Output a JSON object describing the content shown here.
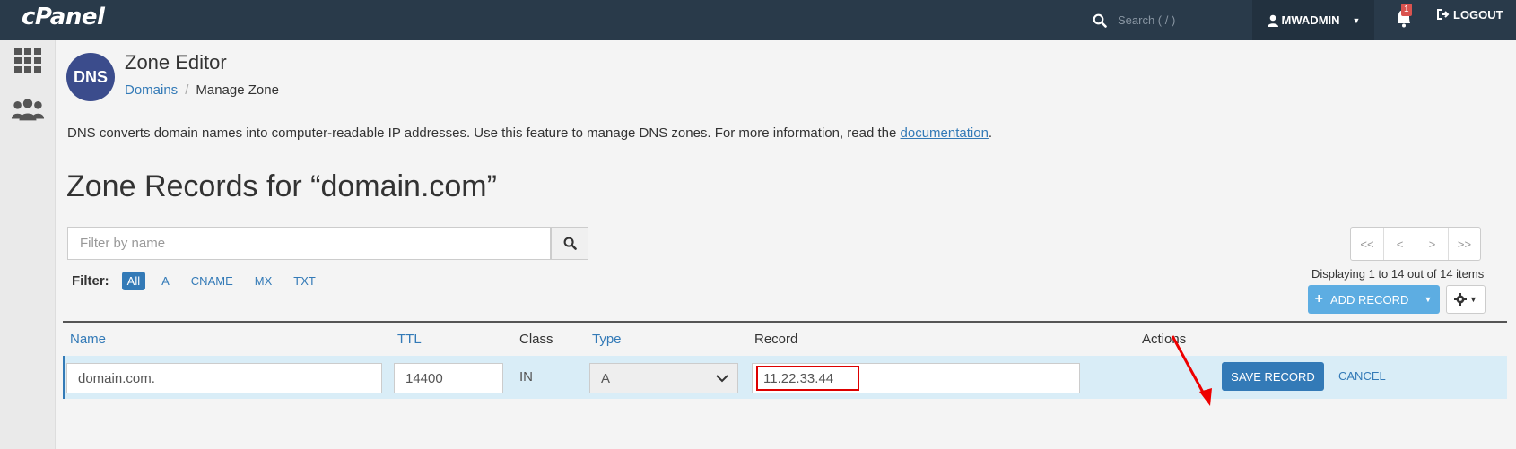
{
  "header": {
    "logo": "cPanel",
    "search_placeholder": "Search ( / )",
    "user": "MWADMIN",
    "notifications_count": "1",
    "logout_label": "LOGOUT"
  },
  "sidebar": {
    "items": [
      {
        "icon": "grid-icon"
      },
      {
        "icon": "users-icon"
      }
    ]
  },
  "page": {
    "logo_text": "DNS",
    "title": "Zone Editor",
    "breadcrumb": [
      "Domains",
      "Manage Zone"
    ],
    "description_prefix": "DNS converts domain names into computer-readable IP addresses. Use this feature to manage DNS zones. For more information, read the ",
    "description_link": "documentation",
    "description_suffix": ".",
    "zone_title": "Zone Records for “domain.com”"
  },
  "filter": {
    "placeholder": "Filter by name",
    "label": "Filter:",
    "options": [
      "All",
      "A",
      "CNAME",
      "MX",
      "TXT"
    ],
    "active": "All"
  },
  "pager": {
    "buttons": [
      "<<",
      "<",
      ">",
      ">>"
    ],
    "display_text": "Displaying 1 to 14 out of 14 items"
  },
  "toolbar": {
    "add_label": "ADD RECORD"
  },
  "table": {
    "columns": [
      "Name",
      "TTL",
      "Class",
      "Type",
      "Record",
      "Actions"
    ],
    "edit_row": {
      "name": "domain.com.",
      "ttl": "14400",
      "class": "IN",
      "type": "A",
      "record": "11.22.33.44",
      "save_label": "SAVE RECORD",
      "cancel_label": "CANCEL"
    }
  },
  "colors": {
    "topbar": "#293a4a",
    "link": "#337ab7",
    "edit_row": "#d9edf7",
    "annotation": "#dd0000"
  }
}
